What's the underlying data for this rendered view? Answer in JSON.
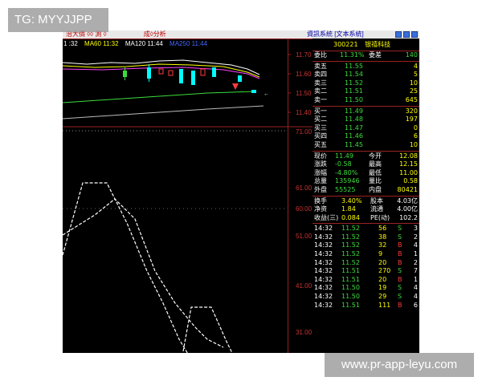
{
  "watermark_top": "TG: MYYJJPP",
  "watermark_bottom": "www.pr-app-leyu.com",
  "titlebar": {
    "left": "治大價 ◊◊ 測 ◊",
    "mid": "成◊分析",
    "right": "資訊系統 [文本系統]"
  },
  "ma_legend": {
    "ma1": "1 :32",
    "ma2": "MA60 11:32",
    "ma3": "MA120 11:44",
    "ma4": "MA250 11:44"
  },
  "price_axis": [
    "11.70",
    "11.60",
    "11.50",
    "11.40"
  ],
  "indicator_axis": [
    "71.00",
    "61.00",
    "60.00",
    "51.00",
    "41.00",
    "31.00"
  ],
  "stock": {
    "code": "300221",
    "name": "银禧科技"
  },
  "summary": {
    "weibi_label": "委比",
    "weibi_value": "11.31%",
    "weicha_label": "委差",
    "weicha_value": "140"
  },
  "asks": [
    {
      "label": "卖五",
      "price": "11.55",
      "vol": "4"
    },
    {
      "label": "卖四",
      "price": "11.54",
      "vol": "5"
    },
    {
      "label": "卖三",
      "price": "11.52",
      "vol": "10"
    },
    {
      "label": "卖二",
      "price": "11.51",
      "vol": "25"
    },
    {
      "label": "卖一",
      "price": "11.50",
      "vol": "645"
    }
  ],
  "bids": [
    {
      "label": "买一",
      "price": "11.49",
      "vol": "320"
    },
    {
      "label": "买二",
      "price": "11.48",
      "vol": "197"
    },
    {
      "label": "买三",
      "price": "11.47",
      "vol": "0"
    },
    {
      "label": "买四",
      "price": "11.46",
      "vol": "6"
    },
    {
      "label": "买五",
      "price": "11.45",
      "vol": "10"
    }
  ],
  "stats": [
    {
      "l1": "现价",
      "v1": "11.49",
      "l2": "今开",
      "v2": "12.08"
    },
    {
      "l1": "涨跌",
      "v1": "-0.58",
      "l2": "最高",
      "v2": "12.15"
    },
    {
      "l1": "涨幅",
      "v1": "-4.80%",
      "l2": "最低",
      "v2": "11.00"
    },
    {
      "l1": "总量",
      "v1": "135946",
      "l2": "量比",
      "v2": "0.58"
    },
    {
      "l1": "外盘",
      "v1": "55525",
      "l2": "内盘",
      "v2": "80421"
    }
  ],
  "stats2": [
    {
      "l1": "换手",
      "v1": "3.40%",
      "l2": "股本",
      "v2": "4.03亿"
    },
    {
      "l1": "净资",
      "v1": "1.84",
      "l2": "流通",
      "v2": "4.00亿"
    },
    {
      "l1": "收益(三)",
      "v1": "0.084",
      "l2": "PE(动)",
      "v2": "102.2"
    }
  ],
  "ticks": [
    {
      "t": "14:32",
      "p": "11.52",
      "v": "56",
      "s": "S",
      "n": "3"
    },
    {
      "t": "14:32",
      "p": "11.52",
      "v": "38",
      "s": "S",
      "n": "2"
    },
    {
      "t": "14:32",
      "p": "11.52",
      "v": "32",
      "s": "B",
      "n": "4"
    },
    {
      "t": "14:32",
      "p": "11.52",
      "v": "9",
      "s": "B",
      "n": "1"
    },
    {
      "t": "14:32",
      "p": "11.52",
      "v": "20",
      "s": "B",
      "n": "2"
    },
    {
      "t": "14:32",
      "p": "11.51",
      "v": "270",
      "s": "S",
      "n": "7"
    },
    {
      "t": "14:32",
      "p": "11.51",
      "v": "20",
      "s": "B",
      "n": "1"
    },
    {
      "t": "14:32",
      "p": "11.50",
      "v": "19",
      "s": "S",
      "n": "4"
    },
    {
      "t": "14:32",
      "p": "11.50",
      "v": "29",
      "s": "S",
      "n": "4"
    },
    {
      "t": "14:32",
      "p": "11.51",
      "v": "111",
      "s": "B",
      "n": "6"
    }
  ],
  "colors": {
    "up": "#ff3c3c",
    "down": "#3cdc3c",
    "accent": "#ffff00",
    "grid": "#992222"
  }
}
